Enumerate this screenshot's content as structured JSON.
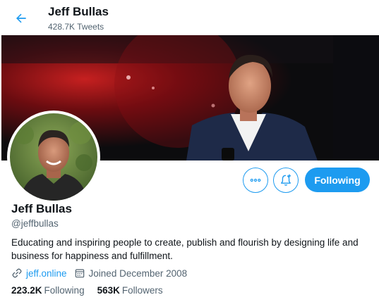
{
  "header": {
    "title": "Jeff Bullas",
    "subtitle": "428.7K Tweets",
    "back_icon": "arrow-left-icon"
  },
  "profile": {
    "name": "Jeff Bullas",
    "handle": "@jeffbullas",
    "bio": "Educating and inspiring people to create, publish and flourish by designing life and business for happiness and fulfillment.",
    "website": "jeff.online",
    "joined": "Joined December 2008"
  },
  "stats": {
    "following_count": "223.2K",
    "following_label": "Following",
    "followers_count": "563K",
    "followers_label": "Followers"
  },
  "actions": {
    "more_icon": "more-icon",
    "notify_icon": "bell-plus-icon",
    "follow_label": "Following"
  },
  "colors": {
    "accent": "#1d9bf0",
    "text": "#0f1419",
    "secondary": "#536471"
  }
}
